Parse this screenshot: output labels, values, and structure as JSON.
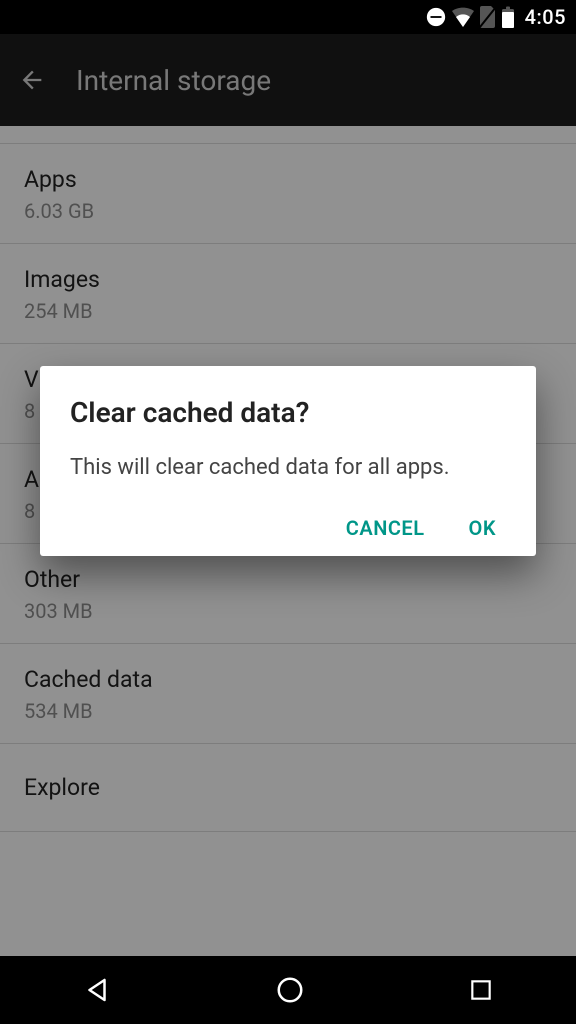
{
  "status": {
    "time": "4:05"
  },
  "header": {
    "title": "Internal storage"
  },
  "items": [
    {
      "label": "Apps",
      "sub": "6.03 GB"
    },
    {
      "label": "Images",
      "sub": "254 MB"
    },
    {
      "label": "Videos",
      "sub": "8"
    },
    {
      "label": "Audio",
      "sub": "8"
    },
    {
      "label": "Other",
      "sub": "303 MB"
    },
    {
      "label": "Cached data",
      "sub": "534 MB"
    },
    {
      "label": "Explore",
      "sub": ""
    }
  ],
  "dialog": {
    "title": "Clear cached data?",
    "body": "This will clear cached data for all apps.",
    "cancel": "CANCEL",
    "ok": "OK"
  },
  "colors": {
    "accent": "#009688"
  }
}
